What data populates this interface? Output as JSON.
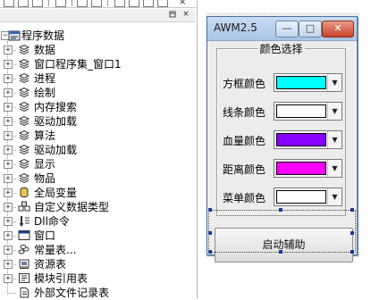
{
  "ide": {
    "toolbar_close": "×",
    "panel_buttons": [
      "×"
    ]
  },
  "tree": {
    "root": "程序数据",
    "items": [
      {
        "label": "数据",
        "icon": "stack-icon"
      },
      {
        "label": "窗口程序集_窗口1",
        "icon": "stack-icon"
      },
      {
        "label": "进程",
        "icon": "stack-icon"
      },
      {
        "label": "绘制",
        "icon": "stack-icon"
      },
      {
        "label": "内存搜索",
        "icon": "stack-icon"
      },
      {
        "label": "驱动加载",
        "icon": "stack-icon"
      },
      {
        "label": "算法",
        "icon": "stack-icon"
      },
      {
        "label": "驱动加载",
        "icon": "stack-icon"
      },
      {
        "label": "显示",
        "icon": "stack-icon"
      },
      {
        "label": "物品",
        "icon": "stack-icon"
      },
      {
        "label": "全局变量",
        "icon": "cylinder-icon"
      },
      {
        "label": "自定义数据类型",
        "icon": "blocks-icon"
      },
      {
        "label": "Dll命令",
        "icon": "dll-icon"
      },
      {
        "label": "窗口",
        "icon": "window-icon"
      },
      {
        "label": "常量表...",
        "icon": "constants-icon"
      },
      {
        "label": "资源表",
        "icon": "resources-icon"
      },
      {
        "label": "模块引用表",
        "icon": "module-icon"
      },
      {
        "label": "外部文件记录表",
        "icon": "file-icon"
      }
    ]
  },
  "window": {
    "title": "AWM2.5",
    "minimize": "—",
    "maximize": "□",
    "close": "✕",
    "group_title": "颜色选择",
    "rows": [
      {
        "label": "方框颜色",
        "color": "#00ffff"
      },
      {
        "label": "线条颜色",
        "color": "#ffffff"
      },
      {
        "label": "血量颜色",
        "color": "#8800ff"
      },
      {
        "label": "距离颜色",
        "color": "#ff00ff"
      },
      {
        "label": "菜单颜色",
        "color": "#ffffff"
      }
    ],
    "dropdown_arrow": "▼",
    "start_button": "启动辅助"
  }
}
